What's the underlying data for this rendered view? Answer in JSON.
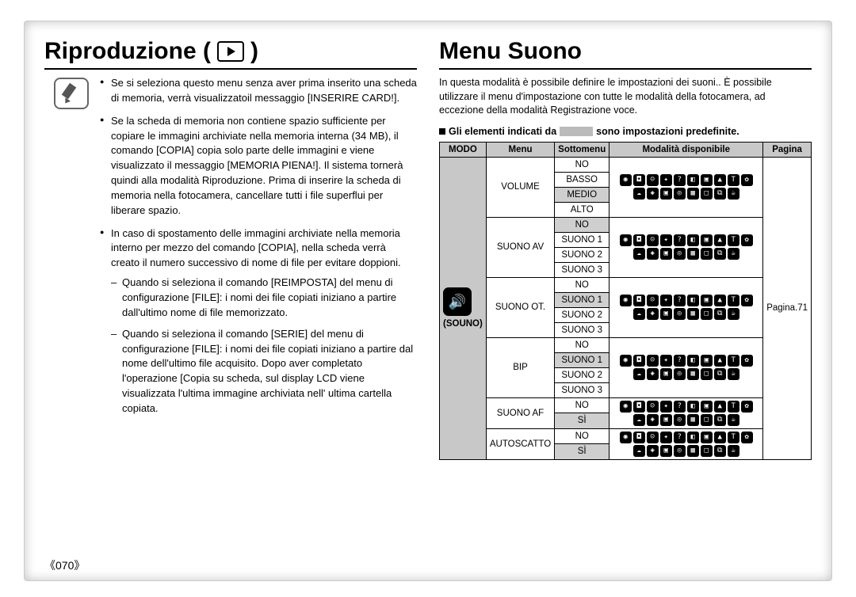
{
  "page_number": "《070》",
  "left": {
    "heading": "Riproduzione (",
    "heading_tail": ")",
    "bullets": [
      "Se si seleziona questo menu senza aver prima inserito una scheda di memoria, verrà visualizzatoil messaggio [INSERIRE CARD!].",
      "Se la scheda di memoria non contiene spazio sufficiente per copiare le immagini archiviate nella memoria interna (34 MB), il comando [COPIA] copia solo parte delle immagini e viene visualizzato il messaggio [MEMORIA PIENA!]. Il sistema tornerà quindi alla modalità Riproduzione. Prima di inserire la scheda di memoria nella fotocamera, cancellare tutti i file superflui per liberare spazio.",
      "In caso di spostamento delle immagini archiviate nella memoria interno per mezzo del comando [COPIA], nella scheda verrà creato il numero successivo di nome di file per evitare doppioni."
    ],
    "dashes": [
      "Quando si seleziona il comando [REIMPOSTA] del menu di configurazione [FILE]: i nomi dei file copiati iniziano a partire dall'ultimo nome di file memorizzato.",
      "Quando si seleziona il comando [SERIE] del menu di configurazione [FILE]: i nomi dei file copiati iniziano a partire dal nome dell'ultimo file acquisito. Dopo aver completato l'operazione [Copia su scheda, sul display LCD viene visualizzata l'ultima immagine archiviata nell' ultima cartella copiata."
    ]
  },
  "right": {
    "heading": "Menu Suono",
    "intro": "In questa modalità è possibile definire le impostazioni dei suoni.. È possibile utilizzare il menu d'impostazione con tutte le modalità della fotocamera, ad eccezione della modalità Registrazione voce.",
    "legend_before": "Gli elementi indicati da",
    "legend_after": "sono impostazioni predefinite.",
    "table": {
      "headers": {
        "c1": "MODO",
        "c2": "Menu",
        "c3": "Sottomenu",
        "c4": "Modalità disponibile",
        "c5": "Pagina"
      },
      "modo_label": "(SOUNO)",
      "page_ref": "Pagina.71",
      "groups": [
        {
          "menu": "VOLUME",
          "subs": [
            "NO",
            "BASSO",
            "MEDIO",
            "ALTO"
          ],
          "default_idx": 2
        },
        {
          "menu": "SUONO AV",
          "subs": [
            "NO",
            "SUONO 1",
            "SUONO 2",
            "SUONO 3"
          ],
          "default_idx": 0
        },
        {
          "menu": "SUONO OT.",
          "subs": [
            "NO",
            "SUONO 1",
            "SUONO 2",
            "SUONO 3"
          ],
          "default_idx": 1
        },
        {
          "menu": "BIP",
          "subs": [
            "NO",
            "SUONO 1",
            "SUONO 2",
            "SUONO 3"
          ],
          "default_idx": 1
        },
        {
          "menu": "SUONO AF",
          "subs": [
            "NO",
            "SÌ"
          ],
          "default_idx": 1
        },
        {
          "menu": "AUTOSCATTO",
          "subs": [
            "NO",
            "SÌ"
          ],
          "default_idx": 1
        }
      ],
      "mode_icons": [
        "◉",
        "◘",
        "☺",
        "✦",
        "?",
        "◧",
        "▣",
        "▲",
        "T",
        "✿",
        "☁",
        "◈",
        "▣",
        "◎",
        "▦",
        "□",
        "⧉",
        "☕"
      ]
    }
  }
}
